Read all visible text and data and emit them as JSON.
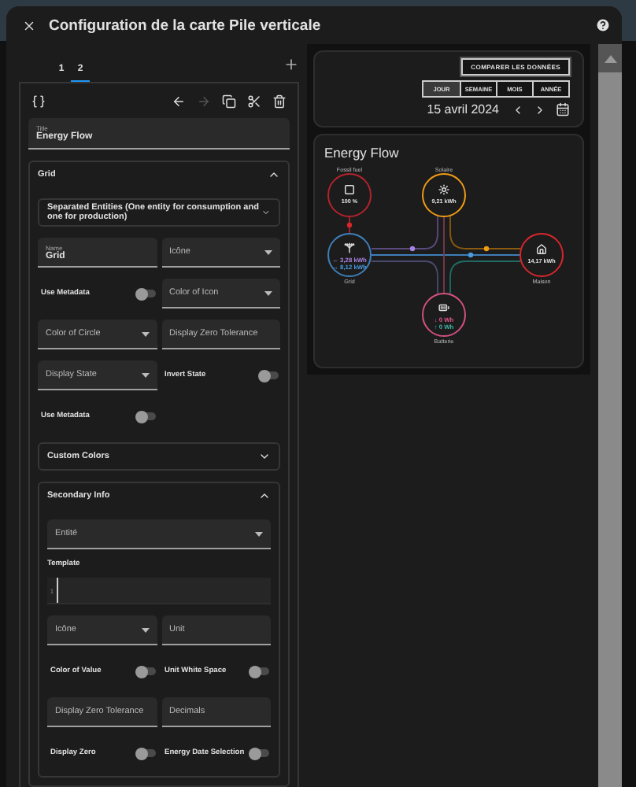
{
  "dialog": {
    "title": "Configuration de la carte Pile verticale"
  },
  "editor": {
    "tabs": [
      {
        "label": "1",
        "selected": false
      },
      {
        "label": "2",
        "selected": true
      }
    ],
    "title_field": {
      "label": "Title",
      "value": "Energy Flow"
    },
    "section": {
      "title": "Grid",
      "expanded": true,
      "children": [
        {
          "kind": "expander",
          "title": "Separated Entities (One entity for consumption and one for production)",
          "expanded": false
        },
        {
          "kind": "fields",
          "fields": [
            {
              "kind": "text",
              "label": "Name",
              "value": "Grid"
            },
            {
              "kind": "select",
              "label": "Icône"
            },
            {
              "kind": "toggle",
              "label": "Use Metadata",
              "on": false
            },
            {
              "kind": "select",
              "label": "Color of Icon"
            },
            {
              "kind": "select",
              "label": "Color of Circle"
            },
            {
              "kind": "text",
              "label": "Display Zero Tolerance"
            },
            {
              "kind": "select",
              "label": "Display State"
            },
            {
              "kind": "toggle",
              "label": "Invert State",
              "on": false
            },
            {
              "kind": "toggle",
              "label": "Use Metadata",
              "on": false
            }
          ]
        },
        {
          "kind": "expander",
          "title": "Custom Colors",
          "expanded": false
        },
        {
          "kind": "expander",
          "title": "Secondary Info",
          "expanded": true,
          "children": [
            {
              "kind": "fields",
              "fields": [
                {
                  "kind": "select",
                  "label": "Entité",
                  "wide": true
                },
                {
                  "kind": "code",
                  "label": "Template",
                  "line": "1",
                  "wide": true
                },
                {
                  "kind": "select",
                  "label": "Icône"
                },
                {
                  "kind": "text",
                  "label": "Unit"
                },
                {
                  "kind": "toggle",
                  "label": "Color of Value",
                  "on": false
                },
                {
                  "kind": "toggle",
                  "label": "Unit White Space",
                  "on": false
                },
                {
                  "kind": "text",
                  "label": "Display Zero Tolerance"
                },
                {
                  "kind": "text",
                  "label": "Decimals"
                },
                {
                  "kind": "toggle",
                  "label": "Display Zero",
                  "on": false
                },
                {
                  "kind": "toggle",
                  "label": "Energy Date Selection",
                  "on": false
                }
              ]
            }
          ]
        }
      ]
    }
  },
  "preview": {
    "compare_button": "COMPARER LES DONNÉES",
    "periods": [
      {
        "label": "JOUR",
        "selected": true
      },
      {
        "label": "SEMAINE",
        "selected": false
      },
      {
        "label": "MOIS",
        "selected": false
      },
      {
        "label": "ANNÉE",
        "selected": false
      }
    ],
    "date": "15 avril 2024",
    "energy_flow": {
      "title": "Energy Flow",
      "nodes": [
        {
          "kind": "fossil",
          "label": "Fossil fuel",
          "color": "#b4232c",
          "lines": [
            {
              "text": "100 %",
              "color": "#e1e1e1"
            }
          ]
        },
        {
          "kind": "solar",
          "label": "Solaire",
          "color": "#f19c16",
          "lines": [
            {
              "text": "9,21 kWh",
              "color": "#e1e1e1"
            }
          ]
        },
        {
          "kind": "grid",
          "label": "Grid",
          "color": "#3f7fb8",
          "lines": [
            {
              "text": "← 3,28 kWh",
              "color": "#a983e0"
            },
            {
              "text": "→ 8,12 kWh",
              "color": "#4a9be0"
            }
          ]
        },
        {
          "kind": "home",
          "label": "Maison",
          "color": "#d8262d",
          "lines": [
            {
              "text": "14,17 kWh",
              "color": "#e1e1e1"
            }
          ]
        },
        {
          "kind": "battery",
          "label": "Batterie",
          "color": "#d3517f",
          "lines": [
            {
              "text": "↓ 0 Wh",
              "color": "#e0568c"
            },
            {
              "text": "↑ 0 Wh",
              "color": "#3fb5a6"
            }
          ]
        }
      ]
    }
  }
}
